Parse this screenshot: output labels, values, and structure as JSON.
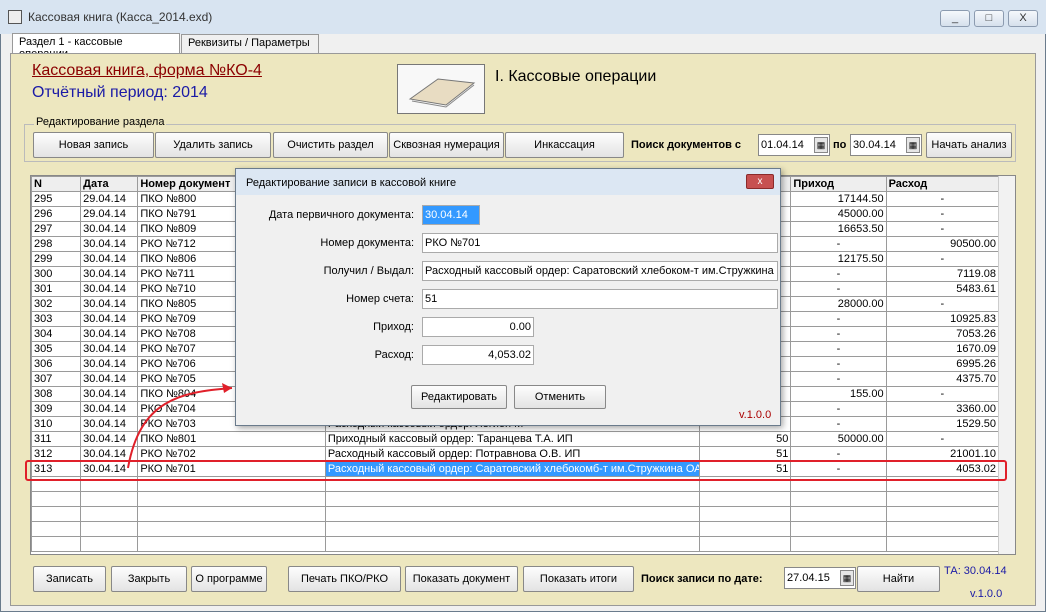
{
  "window": {
    "title": "Кассовая книга (Касса_2014.exd)",
    "min": "_",
    "max": "□",
    "close": "X"
  },
  "tabs": [
    {
      "label": "Раздел 1 - кассовые операции"
    },
    {
      "label": "Реквизиты / Параметры"
    }
  ],
  "header": {
    "form_title": "Кассовая книга, форма №КО-4",
    "period": "Отчётный период: 2014",
    "section_title": "I. Кассовые операции"
  },
  "edit_group": {
    "label": "Редактирование раздела",
    "new": "Новая запись",
    "delete": "Удалить запись",
    "clear": "Очистить раздел",
    "numbering": "Сквозная нумерация",
    "collection": "Инкассация",
    "search_label": "Поиск документов с",
    "date_from": "01.04.14",
    "to_label": "по",
    "date_to": "30.04.14",
    "start": "Начать анализ"
  },
  "table": {
    "headers": [
      "N",
      "Дата",
      "Номер документ",
      "",
      "",
      "Приход",
      "Расход"
    ],
    "rows": [
      [
        "295",
        "29.04.14",
        "ПКО №800",
        "",
        "",
        "17144.50",
        "-"
      ],
      [
        "296",
        "29.04.14",
        "ПКО №791",
        "",
        "",
        "45000.00",
        "-"
      ],
      [
        "297",
        "30.04.14",
        "ПКО №809",
        "",
        "",
        "16653.50",
        "-"
      ],
      [
        "298",
        "30.04.14",
        "РКО №712",
        "",
        "",
        "-",
        "90500.00"
      ],
      [
        "299",
        "30.04.14",
        "ПКО №806",
        "",
        "",
        "12175.50",
        "-"
      ],
      [
        "300",
        "30.04.14",
        "РКО №711",
        "",
        "",
        "-",
        "7119.08"
      ],
      [
        "301",
        "30.04.14",
        "РКО №710",
        "",
        "",
        "-",
        "5483.61"
      ],
      [
        "302",
        "30.04.14",
        "ПКО №805",
        "",
        "",
        "28000.00",
        "-"
      ],
      [
        "303",
        "30.04.14",
        "РКО №709",
        "",
        "",
        "-",
        "10925.83"
      ],
      [
        "304",
        "30.04.14",
        "РКО №708",
        "",
        "",
        "-",
        "7053.26"
      ],
      [
        "305",
        "30.04.14",
        "РКО №707",
        "",
        "",
        "-",
        "1670.09"
      ],
      [
        "306",
        "30.04.14",
        "РКО №706",
        "",
        "",
        "-",
        "6995.26"
      ],
      [
        "307",
        "30.04.14",
        "РКО №705",
        "",
        "",
        "-",
        "4375.70"
      ],
      [
        "308",
        "30.04.14",
        "ПКО №804",
        "",
        "",
        "155.00",
        "-"
      ],
      [
        "309",
        "30.04.14",
        "РКО №704",
        "",
        "",
        "-",
        "3360.00"
      ],
      [
        "310",
        "30.04.14",
        "РКО №703",
        "Расходный кассовый ордер: Легион М",
        "",
        "-",
        "1529.50"
      ],
      [
        "311",
        "30.04.14",
        "ПКО №801",
        "Приходный кассовый ордер: Таранцева Т.А. ИП",
        "50",
        "50000.00",
        "-"
      ],
      [
        "312",
        "30.04.14",
        "РКО №702",
        "Расходный кассовый ордер: Потравнова О.В. ИП",
        "51",
        "-",
        "21001.10"
      ],
      [
        "313",
        "30.04.14",
        "РКО №701",
        "Расходный кассовый ордер: Саратовский хлебокомб-т им.Стружкина ОА",
        "51",
        "-",
        "4053.02"
      ]
    ]
  },
  "dialog": {
    "title": "Редактирование записи в кассовой книге",
    "close": "x",
    "date_label": "Дата первичного документа:",
    "date_value": "30.04.14",
    "docnum_label": "Номер документа:",
    "docnum_value": "РКО №701",
    "payee_label": "Получил / Выдал:",
    "payee_value": "Расходный кассовый ордер: Саратовский хлебоком-т им.Стружкина",
    "account_label": "Номер счета:",
    "account_value": "51",
    "income_label": "Приход:",
    "income_value": "0.00",
    "expense_label": "Расход:",
    "expense_value": "4,053.02",
    "edit_btn": "Редактировать",
    "cancel_btn": "Отменить",
    "version": "v.1.0.0"
  },
  "footer": {
    "save": "Записать",
    "close": "Закрыть",
    "about": "О программе",
    "print": "Печать ПКО/РКО",
    "show_doc": "Показать документ",
    "show_totals": "Показать итоги",
    "search_label": "Поиск записи по дате:",
    "search_date": "27.04.15",
    "find": "Найти",
    "ta": "ТА: 30.04.14",
    "version": "v.1.0.0"
  },
  "icons": {
    "calendar": "calendar-icon",
    "book": "book-icon"
  },
  "colors": {
    "highlight": "#3399ff",
    "red_box": "#e0202a",
    "form_title": "#8b0000",
    "period": "#1a1aa6"
  }
}
